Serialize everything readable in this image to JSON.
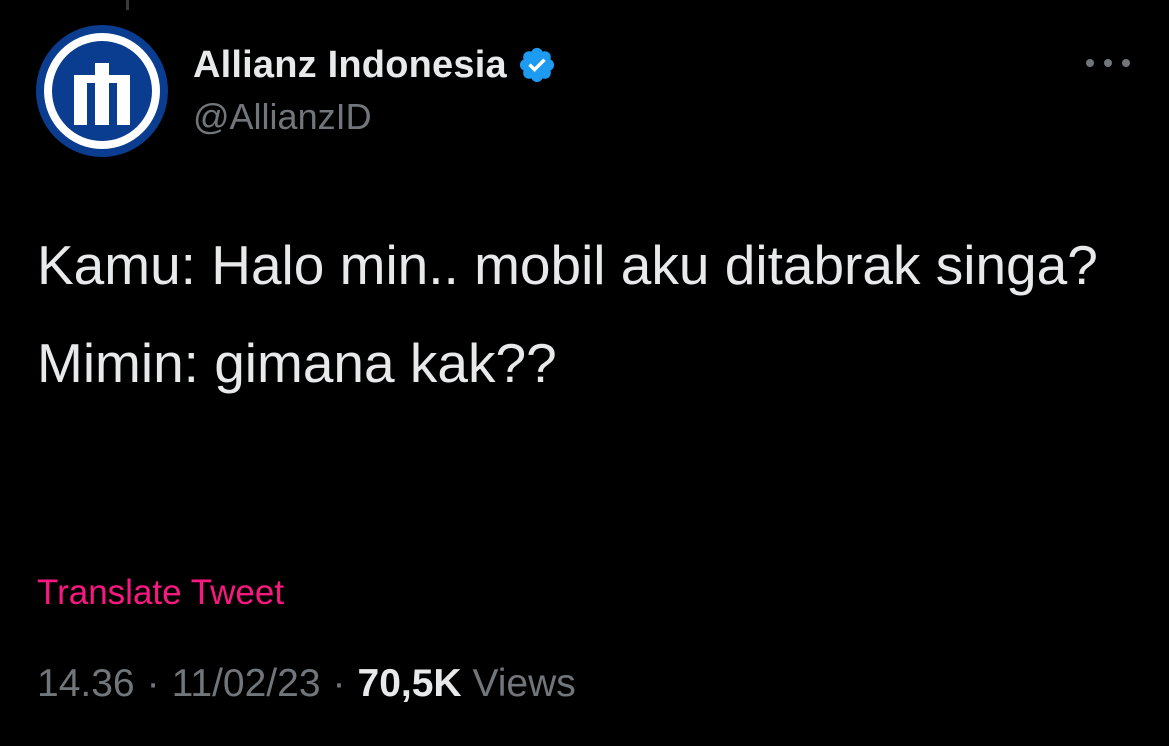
{
  "app": {
    "background_color": "#000000"
  },
  "author": {
    "display_name": "Allianz Indonesia",
    "handle": "@AllianzID",
    "verified": true,
    "avatar_icon": "allianz-logo-icon",
    "verified_icon": "verified-badge-icon",
    "verified_color": "#1d9bf0",
    "avatar_color": "#0a3d8f"
  },
  "menu": {
    "icon": "more-options-icon"
  },
  "tweet": {
    "lines": [
      "Kamu: Halo min.. mobil aku ditabrak singa?",
      "Mimin: gimana kak??"
    ]
  },
  "translate": {
    "label": "Translate Tweet",
    "color": "#f91880"
  },
  "meta": {
    "time": "14.36",
    "separator": "·",
    "date": "11/02/23",
    "views_count": "70,5K",
    "views_label": "Views"
  }
}
